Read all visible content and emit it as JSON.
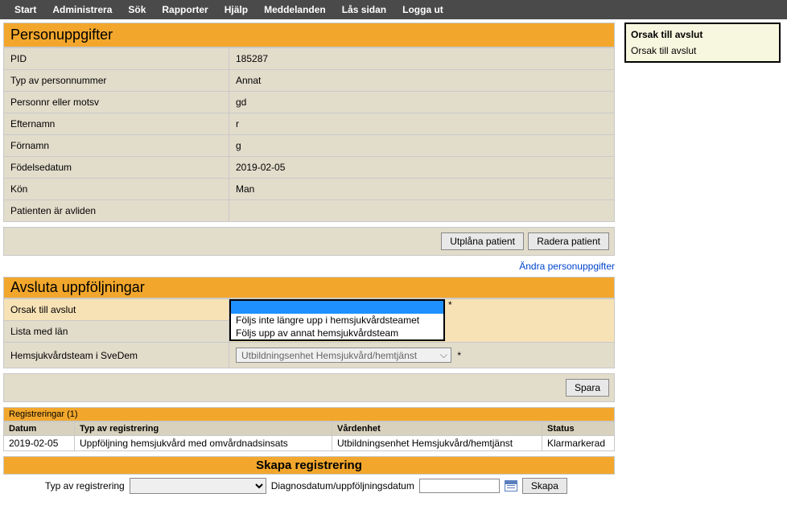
{
  "nav": {
    "start": "Start",
    "admin": "Administrera",
    "search": "Sök",
    "reports": "Rapporter",
    "help": "Hjälp",
    "messages": "Meddelanden",
    "lock": "Lås sidan",
    "logout": "Logga ut"
  },
  "person": {
    "header": "Personuppgifter",
    "pid_label": "PID",
    "pid_value": "185287",
    "type_label": "Typ av personnummer",
    "type_value": "Annat",
    "pnr_label": "Personnr eller motsv",
    "pnr_value": "gd",
    "lastname_label": "Efternamn",
    "lastname_value": "r",
    "firstname_label": "Förnamn",
    "firstname_value": "g",
    "birth_label": "Födelsedatum",
    "birth_value": "2019-02-05",
    "gender_label": "Kön",
    "gender_value": "Man",
    "deceased_label": "Patienten är avliden",
    "deceased_value": "",
    "btn_delete": "Utplåna patient",
    "btn_remove": "Radera patient",
    "link_edit": "Ändra personuppgifter"
  },
  "close": {
    "header": "Avsluta uppföljningar",
    "reason_label": "Orsak till avslut",
    "option1": "Följs inte längre upp i hemsjukvårdsteamet",
    "option2": "Följs upp av annat hemsjukvårdsteam",
    "county_label": "Lista med län",
    "team_label": "Hemsjukvårdsteam i SveDem",
    "team_value": "Utbildningsenhet Hemsjukvård/hemtjänst",
    "req": "*",
    "btn_save": "Spara"
  },
  "regs": {
    "count_header": "Registreringar (1)",
    "col_date": "Datum",
    "col_type": "Typ av registrering",
    "col_unit": "Vårdenhet",
    "col_status": "Status",
    "row_date": "2019-02-05",
    "row_type": "Uppföljning hemsjukvård med omvårdnadsinsats",
    "row_unit": "Utbildningsenhet Hemsjukvård/hemtjänst",
    "row_status": "Klarmarkerad"
  },
  "create": {
    "header": "Skapa registrering",
    "type_label": "Typ av registrering",
    "date_label": "Diagnosdatum/uppföljningsdatum",
    "btn": "Skapa"
  },
  "side": {
    "header": "Orsak till avslut",
    "text": "Orsak till avslut"
  }
}
